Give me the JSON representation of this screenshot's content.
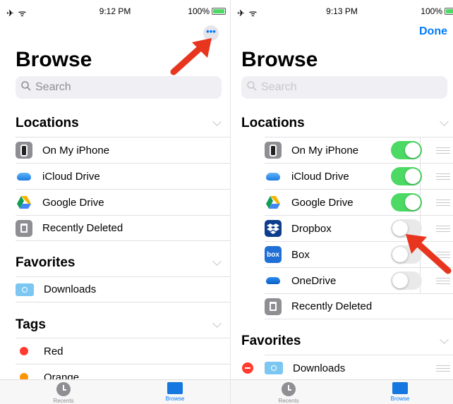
{
  "left": {
    "status": {
      "icons": "✈ ᯤ",
      "time": "9:12 PM",
      "battery": "100%"
    },
    "more_label": "•••",
    "title": "Browse",
    "search_placeholder": "Search",
    "locations_header": "Locations",
    "locations": [
      {
        "label": "On My iPhone",
        "icon": "phone-icon"
      },
      {
        "label": "iCloud Drive",
        "icon": "icloud-icon"
      },
      {
        "label": "Google Drive",
        "icon": "google-drive-icon"
      },
      {
        "label": "Recently Deleted",
        "icon": "trash-icon"
      }
    ],
    "favorites_header": "Favorites",
    "favorites": [
      {
        "label": "Downloads",
        "icon": "folder-icon"
      }
    ],
    "tags_header": "Tags",
    "tags": [
      {
        "label": "Red",
        "color": "#ff3b30"
      },
      {
        "label": "Orange",
        "color": "#ff9500"
      }
    ],
    "tabs": [
      {
        "label": "Recents"
      },
      {
        "label": "Browse"
      }
    ]
  },
  "right": {
    "status": {
      "icons": "✈ ᯤ",
      "time": "9:13 PM",
      "battery": "100%"
    },
    "done_label": "Done",
    "title": "Browse",
    "search_placeholder": "Search",
    "locations_header": "Locations",
    "locations": [
      {
        "label": "On My iPhone",
        "icon": "phone-icon",
        "enabled": true
      },
      {
        "label": "iCloud Drive",
        "icon": "icloud-icon",
        "enabled": true
      },
      {
        "label": "Google Drive",
        "icon": "google-drive-icon",
        "enabled": true
      },
      {
        "label": "Dropbox",
        "icon": "dropbox-icon",
        "enabled": false
      },
      {
        "label": "Box",
        "icon": "box-icon",
        "icon_text": "box",
        "enabled": false
      },
      {
        "label": "OneDrive",
        "icon": "onedrive-icon",
        "enabled": false
      },
      {
        "label": "Recently Deleted",
        "icon": "trash-icon"
      }
    ],
    "favorites_header": "Favorites",
    "favorites": [
      {
        "label": "Downloads",
        "icon": "folder-icon"
      }
    ],
    "tabs": [
      {
        "label": "Recents"
      },
      {
        "label": "Browse"
      }
    ]
  },
  "colors": {
    "accent": "#007aff",
    "toggle_on": "#4cd964",
    "arrow": "#e8351e"
  }
}
